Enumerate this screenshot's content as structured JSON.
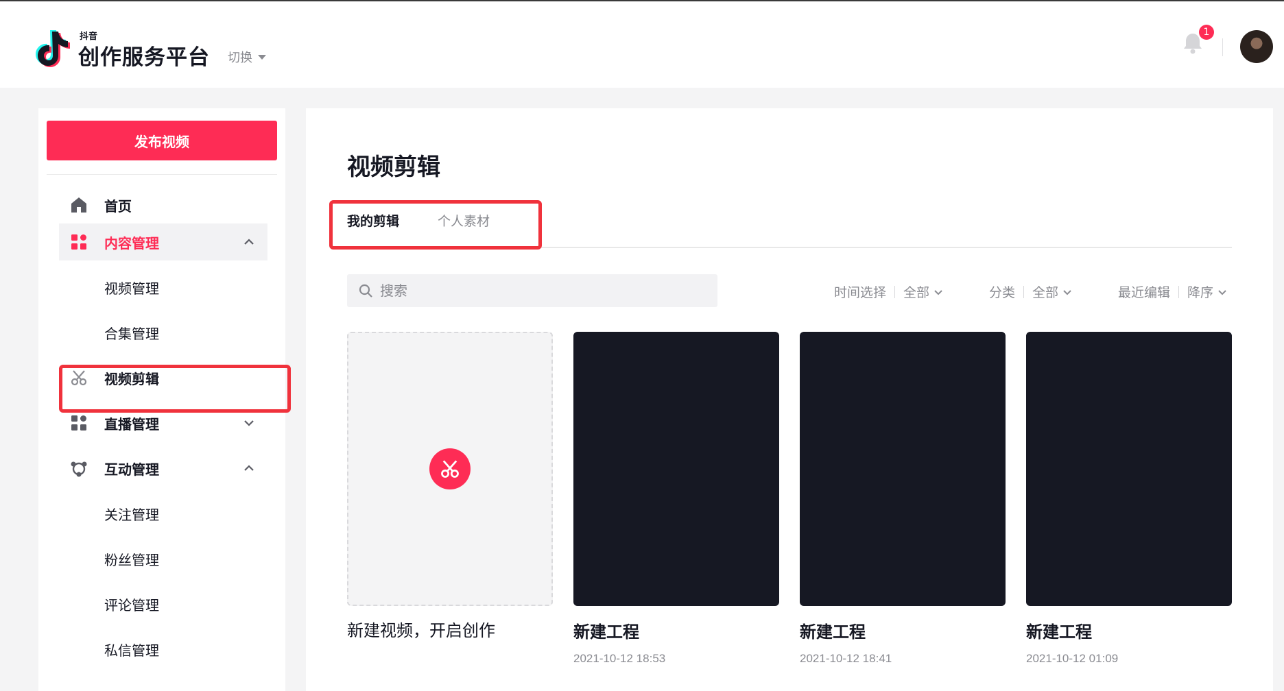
{
  "brand": {
    "small": "抖音",
    "name": "创作服务平台",
    "switch_label": "切换"
  },
  "header": {
    "notification_count": "1"
  },
  "sidebar": {
    "publish_label": "发布视频",
    "items": [
      {
        "label": "首页",
        "icon": "home-icon"
      },
      {
        "label": "内容管理",
        "icon": "grid-icon",
        "expanded": true
      },
      {
        "label": "视频管理"
      },
      {
        "label": "合集管理"
      },
      {
        "label": "视频剪辑",
        "icon": "scissors-icon",
        "current": true
      },
      {
        "label": "直播管理",
        "icon": "grid-icon",
        "expanded": false
      },
      {
        "label": "互动管理",
        "icon": "interaction-icon",
        "expanded": true
      },
      {
        "label": "关注管理"
      },
      {
        "label": "粉丝管理"
      },
      {
        "label": "评论管理"
      },
      {
        "label": "私信管理"
      }
    ]
  },
  "main": {
    "title": "视频剪辑",
    "tabs": [
      {
        "label": "我的剪辑",
        "active": true
      },
      {
        "label": "个人素材",
        "active": false
      }
    ],
    "search_placeholder": "搜索",
    "filters": [
      {
        "label": "时间选择",
        "value": "全部"
      },
      {
        "label": "分类",
        "value": "全部"
      },
      {
        "label": "最近编辑",
        "value": "降序"
      }
    ],
    "new_card_label": "新建视频，开启创作",
    "projects": [
      {
        "name": "新建工程",
        "time": "2021-10-12 18:53"
      },
      {
        "name": "新建工程",
        "time": "2021-10-12 18:41"
      },
      {
        "name": "新建工程",
        "time": "2021-10-12 01:09"
      }
    ]
  },
  "colors": {
    "accent": "#fe2c55",
    "highlight_box": "#f0323c",
    "thumbnail": "#161823"
  }
}
